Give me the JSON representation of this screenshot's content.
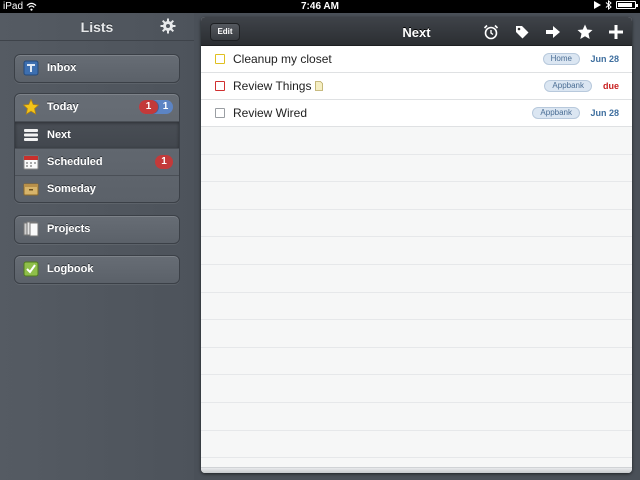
{
  "status_bar": {
    "carrier": "iPad",
    "time": "7:46 AM",
    "battery_level": 0.85
  },
  "sidebar": {
    "title": "Lists",
    "groups": [
      {
        "items": [
          {
            "label": "Inbox",
            "icon": "inbox-icon"
          }
        ]
      },
      {
        "items": [
          {
            "label": "Today",
            "icon": "star-icon",
            "badge_due": "1",
            "badge_count": "1"
          },
          {
            "label": "Next",
            "icon": "next-list-icon",
            "selected": true
          },
          {
            "label": "Scheduled",
            "icon": "calendar-icon",
            "badge_due": "1"
          },
          {
            "label": "Someday",
            "icon": "box-icon"
          }
        ]
      },
      {
        "items": [
          {
            "label": "Projects",
            "icon": "projects-icon"
          }
        ]
      },
      {
        "items": [
          {
            "label": "Logbook",
            "icon": "logbook-icon"
          }
        ]
      }
    ]
  },
  "main": {
    "title": "Next",
    "edit_label": "Edit",
    "toolbar_icons": [
      "alarm-icon",
      "tag-icon",
      "move-arrow-icon",
      "star-icon",
      "add-icon"
    ],
    "tasks": [
      {
        "title": "Cleanup my closet",
        "tag": "Home",
        "date": "Jun 28",
        "checkbox_color": "#e0c020",
        "has_note": false,
        "due": false
      },
      {
        "title": "Review Things",
        "tag": "Appbank",
        "date": "due",
        "checkbox_color": "#d03030",
        "has_note": true,
        "due": true
      },
      {
        "title": "Review Wired",
        "tag": "Appbank",
        "date": "Jun 28",
        "checkbox_color": "#9a9ea3",
        "has_note": false,
        "due": false
      }
    ]
  },
  "colors": {
    "badge_due": "#c33a3a",
    "badge_count": "#5c84c4",
    "due_text": "#c81e1e",
    "date_text": "#3f6f9f",
    "tag_bg": "#dbe6f2"
  }
}
